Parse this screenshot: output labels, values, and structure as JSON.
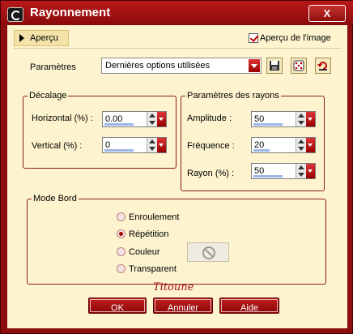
{
  "window": {
    "title": "Rayonnement",
    "close_label": "X"
  },
  "preview": {
    "toggle_label": "Aperçu",
    "checkbox_label": "Aperçu de l'image",
    "checked": true
  },
  "params": {
    "label": "Paramètres",
    "preset_value": "Dernières options utilisées"
  },
  "offset": {
    "group_title": "Décalage",
    "horizontal_label": "Horizontal (%) :",
    "horizontal_value": "0.00",
    "vertical_label": "Vertical (%) :",
    "vertical_value": "0"
  },
  "rays": {
    "group_title": "Paramètres des rayons",
    "amplitude_label": "Amplitude :",
    "amplitude_value": "50",
    "frequency_label": "Fréquence :",
    "frequency_value": "20",
    "radius_label": "Rayon (%) :",
    "radius_value": "50"
  },
  "edge_mode": {
    "group_title": "Mode Bord",
    "options": [
      "Enroulement",
      "Répétition",
      "Couleur",
      "Transparent"
    ],
    "selected": "Répétition"
  },
  "signature": "Titoune",
  "buttons": {
    "ok": "OK",
    "cancel": "Annuler",
    "help": "Aide"
  },
  "colors": {
    "frame": "#8b0d0d",
    "client": "#fdf4cf",
    "accent": "#b00000"
  }
}
